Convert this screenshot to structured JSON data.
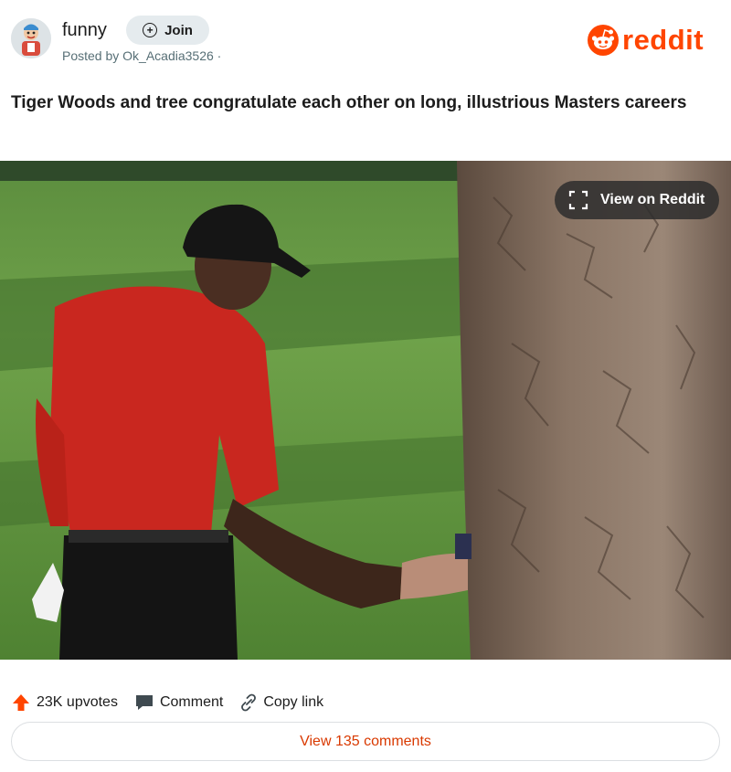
{
  "header": {
    "subreddit": "funny",
    "join_label": "Join",
    "posted_by": "Posted by Ok_Acadia3526 ·",
    "logo_text": "reddit",
    "icons": {
      "join": "plus-circle-icon",
      "logo": "reddit-snoo-icon"
    }
  },
  "post": {
    "title": "Tiger Woods and tree congratulate each other on long, illustrious Masters careers"
  },
  "media": {
    "view_label": "View on Reddit",
    "icons": {
      "view": "expand-icon"
    }
  },
  "actions": {
    "upvotes": "23K upvotes",
    "comment": "Comment",
    "copy_link": "Copy link",
    "icons": {
      "upvote": "upvote-arrow-icon",
      "comment": "comment-bubble-icon",
      "link": "link-icon"
    }
  },
  "footer": {
    "view_comments": "View 135 comments"
  },
  "colors": {
    "brand": "#ff4500",
    "upvote": "#ff4500",
    "link_text": "#d93900",
    "muted": "#576f76",
    "join_bg": "#e5ebee"
  }
}
